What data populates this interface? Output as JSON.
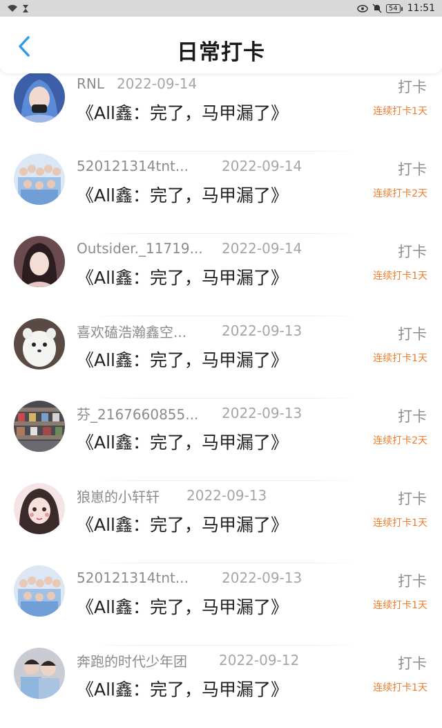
{
  "status_bar": {
    "time": "11:51",
    "battery": "54"
  },
  "header": {
    "title": "日常打卡"
  },
  "items": [
    {
      "username": "RNL",
      "date": "2022-09-14",
      "work": "《All鑫：完了，马甲漏了》",
      "checkin": "打卡",
      "streak": "连续打卡1天"
    },
    {
      "username": "520121314tnt...",
      "date": "2022-09-14",
      "work": "《All鑫：完了，马甲漏了》",
      "checkin": "打卡",
      "streak": "连续打卡2天"
    },
    {
      "username": "Outsider._11719...",
      "date": "2022-09-14",
      "work": "《All鑫：完了，马甲漏了》",
      "checkin": "打卡",
      "streak": "连续打卡1天"
    },
    {
      "username": "喜欢磕浩瀚鑫空...",
      "date": "2022-09-13",
      "work": "《All鑫：完了，马甲漏了》",
      "checkin": "打卡",
      "streak": "连续打卡1天"
    },
    {
      "username": "芬_2167660855...",
      "date": "2022-09-13",
      "work": "《All鑫：完了，马甲漏了》",
      "checkin": "打卡",
      "streak": "连续打卡2天"
    },
    {
      "username": "狼崽的小轩轩",
      "date": "2022-09-13",
      "work": "《All鑫：完了，马甲漏了》",
      "checkin": "打卡",
      "streak": "连续打卡1天"
    },
    {
      "username": "520121314tnt...",
      "date": "2022-09-13",
      "work": "《All鑫：完了，马甲漏了》",
      "checkin": "打卡",
      "streak": "连续打卡1天"
    },
    {
      "username": "奔跑的时代少年团",
      "date": "2022-09-12",
      "work": "《All鑫：完了，马甲漏了》",
      "checkin": "打卡",
      "streak": "连续打卡1天"
    }
  ],
  "colors": {
    "accent_blue": "#2f9be8",
    "streak_orange": "#f07b2b"
  },
  "avatars": [
    "blue-hair-girl",
    "group-photo",
    "girl-portrait",
    "white-ferret",
    "store-shelves",
    "cartoon-girl",
    "group-photo",
    "two-boys"
  ]
}
